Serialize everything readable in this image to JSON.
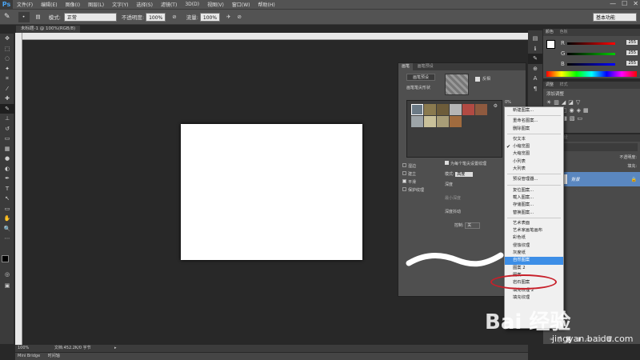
{
  "menubar": {
    "logo": "Ps",
    "items": [
      "文件(F)",
      "编辑(E)",
      "图像(I)",
      "图层(L)",
      "文字(Y)",
      "选择(S)",
      "滤镜(T)",
      "3D(D)",
      "视图(V)",
      "窗口(W)",
      "帮助(H)"
    ],
    "minimize": "—",
    "restore": "☐",
    "close": "✕"
  },
  "options": {
    "mode_label": "模式:",
    "mode_value": "正常",
    "opacity_label": "不透明度:",
    "opacity_value": "100%",
    "flow_label": "流量:",
    "flow_value": "100%",
    "workspace": "基本功能"
  },
  "document": {
    "tab": "未标题-1 @ 100%(RGB/8)",
    "status_zoom": "100%",
    "status_doc": "文档:452.2K/0 字节",
    "minibridge": "Mini Bridge",
    "timeline": "时间轴"
  },
  "color_panel": {
    "tab1": "颜色",
    "tab2": "色板",
    "channels": [
      {
        "label": "R",
        "value": "255"
      },
      {
        "label": "G",
        "value": "255"
      },
      {
        "label": "B",
        "value": "255"
      }
    ]
  },
  "adjust_panel": {
    "tab1": "调整",
    "tab2": "样式",
    "title": "添加调整"
  },
  "layers_panel": {
    "tab1": "图层",
    "tab2": "路径",
    "opacity_label": "不透明度:",
    "fill_label": "填充:",
    "layer_name": "背景"
  },
  "brush_panel": {
    "tab1": "画笔",
    "tab2": "画笔预设",
    "preset_button": "画笔预设",
    "brush_tip": "画笔笔尖形状",
    "invert": "反相",
    "per_tip": "为每个笔尖设置纹理",
    "mode_label": "模式:",
    "mode_value": "高度",
    "depth": "深度",
    "min_depth": "最小深度",
    "depth_jitter": "深度抖动",
    "control_label": "控制:",
    "control_value": "关",
    "options": [
      {
        "label": "湿边",
        "checked": false
      },
      {
        "label": "建立",
        "checked": false
      },
      {
        "label": "平滑",
        "checked": true
      },
      {
        "label": "保护纹理",
        "checked": false
      }
    ],
    "percent": "0%"
  },
  "context_menu": {
    "items": [
      {
        "label": "新建图案...",
        "type": "item"
      },
      {
        "type": "sep"
      },
      {
        "label": "重命名图案...",
        "type": "item"
      },
      {
        "label": "删除图案",
        "type": "item"
      },
      {
        "type": "sep"
      },
      {
        "label": "仅文本",
        "type": "item"
      },
      {
        "label": "小缩览图",
        "type": "item",
        "checked": true
      },
      {
        "label": "大缩览图",
        "type": "item"
      },
      {
        "label": "小列表",
        "type": "item"
      },
      {
        "label": "大列表",
        "type": "item"
      },
      {
        "type": "sep"
      },
      {
        "label": "预设管理器...",
        "type": "item"
      },
      {
        "type": "sep"
      },
      {
        "label": "复位图案...",
        "type": "item"
      },
      {
        "label": "载入图案...",
        "type": "item"
      },
      {
        "label": "存储图案...",
        "type": "item"
      },
      {
        "label": "替换图案...",
        "type": "item"
      },
      {
        "type": "sep"
      },
      {
        "label": "艺术表面",
        "type": "item"
      },
      {
        "label": "艺术家画笔画布",
        "type": "item"
      },
      {
        "label": "彩色纸",
        "type": "item"
      },
      {
        "label": "侵蚀纹理",
        "type": "item"
      },
      {
        "label": "灰度纸",
        "type": "item"
      },
      {
        "label": "自然图案",
        "type": "item",
        "highlight": true
      },
      {
        "label": "图案 2",
        "type": "item"
      },
      {
        "label": "图案",
        "type": "item"
      },
      {
        "label": "岩石图案",
        "type": "item"
      },
      {
        "label": "填充纹理 2",
        "type": "item"
      },
      {
        "label": "填充纹理",
        "type": "item"
      }
    ]
  },
  "watermark": {
    "text": "Bai 经验",
    "url": "jingyan.baidu.com"
  },
  "colors": {
    "highlight": "#3d8ee6",
    "annotation": "#c8202a",
    "ps_blue": "#4aa3f0"
  }
}
